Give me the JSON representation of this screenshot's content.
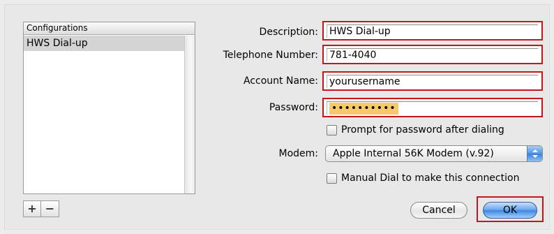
{
  "configurations": {
    "header": "Configurations",
    "items": [
      "HWS Dial-up"
    ]
  },
  "list_controls": {
    "add_label": "+",
    "remove_label": "−"
  },
  "form": {
    "description": {
      "label": "Description:",
      "value": "HWS Dial-up"
    },
    "telephone": {
      "label": "Telephone Number:",
      "value": "781-4040"
    },
    "account": {
      "label": "Account Name:",
      "value": "yourusername"
    },
    "password": {
      "label": "Password:",
      "value": "••••••••••"
    },
    "prompt_checkbox": {
      "label": "Prompt for password after dialing",
      "checked": false
    },
    "modem": {
      "label": "Modem:",
      "selected": "Apple Internal 56K Modem (v.92)"
    },
    "manual_dial_checkbox": {
      "label": "Manual Dial to make this connection",
      "checked": false
    }
  },
  "buttons": {
    "cancel": "Cancel",
    "ok": "OK"
  },
  "colors": {
    "highlight_border": "#c4151c",
    "password_highlight": "#f7c96a",
    "default_button": "#3d85e4"
  }
}
